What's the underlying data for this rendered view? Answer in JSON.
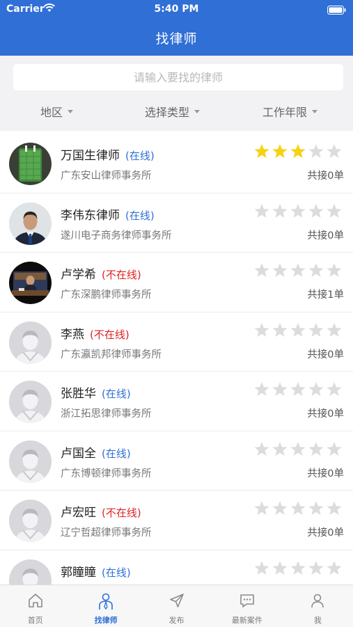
{
  "status_bar": {
    "carrier": "Carrier",
    "time": "5:40 PM"
  },
  "header": {
    "title": "找律师"
  },
  "search": {
    "placeholder": "请输入要找的律师"
  },
  "filters": [
    {
      "label": "地区"
    },
    {
      "label": "选择类型"
    },
    {
      "label": "工作年限"
    }
  ],
  "lawyers": [
    {
      "name": "万国生律师",
      "status": "(在线)",
      "online": true,
      "firm": "广东安山律师事务所",
      "rating": 3,
      "orders": "共接0单",
      "avatar": "green-photo"
    },
    {
      "name": "李伟东律师",
      "status": "(在线)",
      "online": true,
      "firm": "遂川电子商务律师事务所",
      "rating": 0,
      "orders": "共接0单",
      "avatar": "man-photo"
    },
    {
      "name": "卢学希",
      "status": "(不在线)",
      "online": false,
      "firm": "广东深鹏律师事务所",
      "rating": 0,
      "orders": "共接1单",
      "avatar": "desk-photo"
    },
    {
      "name": "李燕",
      "status": "(不在线)",
      "online": false,
      "firm": "广东瀛凯邦律师事务所",
      "rating": 0,
      "orders": "共接0单",
      "avatar": "default"
    },
    {
      "name": "张胜华",
      "status": "(在线)",
      "online": true,
      "firm": "浙江拓思律师事务所",
      "rating": 0,
      "orders": "共接0单",
      "avatar": "default"
    },
    {
      "name": "卢国全",
      "status": "(在线)",
      "online": true,
      "firm": "广东博顿律师事务所",
      "rating": 0,
      "orders": "共接0单",
      "avatar": "default"
    },
    {
      "name": "卢宏旺",
      "status": "(不在线)",
      "online": false,
      "firm": "辽宁哲超律师事务所",
      "rating": 0,
      "orders": "共接0单",
      "avatar": "default"
    },
    {
      "name": "郭瞳瞳",
      "status": "(在线)",
      "online": true,
      "firm": "",
      "rating": 0,
      "orders": "",
      "avatar": "default"
    }
  ],
  "tabs": [
    {
      "label": "首页",
      "icon": "home-icon",
      "active": false
    },
    {
      "label": "找律师",
      "icon": "lawyer-icon",
      "active": true
    },
    {
      "label": "发布",
      "icon": "send-icon",
      "active": false
    },
    {
      "label": "最新案件",
      "icon": "message-icon",
      "active": false
    },
    {
      "label": "我",
      "icon": "profile-icon",
      "active": false
    }
  ],
  "colors": {
    "primary": "#2f6fd6",
    "online": "#2f6fd6",
    "offline": "#e02020",
    "star_on": "#f5d313",
    "star_off": "#dcdcdc"
  }
}
